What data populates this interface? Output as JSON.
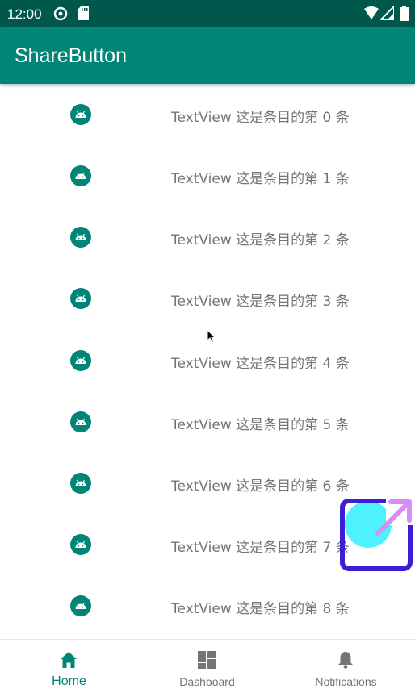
{
  "status_bar": {
    "time": "12:00"
  },
  "app_bar": {
    "title": "ShareButton"
  },
  "list": {
    "items": [
      {
        "label": "TextView  这是条目的第 0 条",
        "icon": "android-icon"
      },
      {
        "label": "TextView  这是条目的第 1 条",
        "icon": "android-icon"
      },
      {
        "label": "TextView  这是条目的第 2 条",
        "icon": "android-icon"
      },
      {
        "label": "TextView  这是条目的第 3 条",
        "icon": "android-icon"
      },
      {
        "label": "TextView  这是条目的第 4 条",
        "icon": "android-icon"
      },
      {
        "label": "TextView  这是条目的第 5 条",
        "icon": "android-icon"
      },
      {
        "label": "TextView  这是条目的第 6 条",
        "icon": "android-icon"
      },
      {
        "label": "TextView  这是条目的第 7 条",
        "icon": "android-icon"
      },
      {
        "label": "TextView  这是条目的第 8 条",
        "icon": "android-icon"
      }
    ]
  },
  "bottom_nav": {
    "items": [
      {
        "label": "Home",
        "icon": "home-icon",
        "active": true
      },
      {
        "label": "Dashboard",
        "icon": "dashboard-icon",
        "active": false
      },
      {
        "label": "Notifications",
        "icon": "bell-icon",
        "active": false
      }
    ]
  },
  "colors": {
    "primary": "#008577",
    "primary_dark": "#00574b",
    "text_secondary": "#757575"
  }
}
